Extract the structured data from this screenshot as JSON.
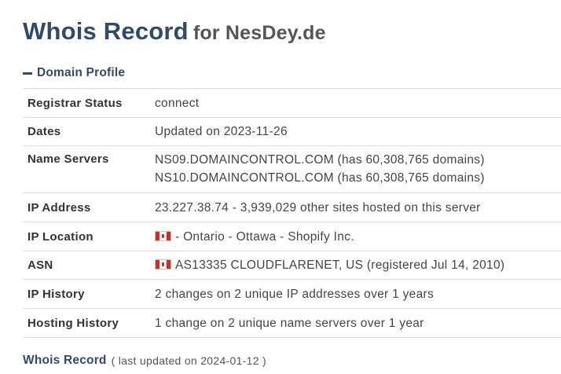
{
  "header": {
    "title": "Whois Record",
    "subtitle": "for NesDey.de"
  },
  "section": {
    "collapse_icon": "minus-icon",
    "title": "Domain Profile"
  },
  "rows": {
    "registrar_status": {
      "label": "Registrar Status",
      "value": "connect"
    },
    "dates": {
      "label": "Dates",
      "value": "Updated on 2023-11-26"
    },
    "name_servers": {
      "label": "Name Servers",
      "values": [
        "NS09.DOMAINCONTROL.COM (has 60,308,765 domains)",
        "NS10.DOMAINCONTROL.COM (has 60,308,765 domains)"
      ]
    },
    "ip_address": {
      "label": "IP Address",
      "value": "23.227.38.74 - 3,939,029 other sites hosted on this server"
    },
    "ip_location": {
      "label": "IP Location",
      "flag_icon": "canada-flag-icon",
      "value": "- Ontario - Ottawa - Shopify Inc."
    },
    "asn": {
      "label": "ASN",
      "flag_icon": "canada-flag-icon",
      "value": "AS13335 CLOUDFLARENET, US (registered Jul 14, 2010)"
    },
    "ip_history": {
      "label": "IP History",
      "value": "2 changes on 2 unique IP addresses over 1 years"
    },
    "hosting_history": {
      "label": "Hosting History",
      "value": "1 change on 2 unique name servers over 1 year"
    }
  },
  "footer": {
    "title": "Whois Record",
    "note": "( last updated on 2024-01-12 )"
  },
  "colors": {
    "accent": "#2f4a6b",
    "flag_red": "#d52b1e",
    "border": "#dedede"
  }
}
